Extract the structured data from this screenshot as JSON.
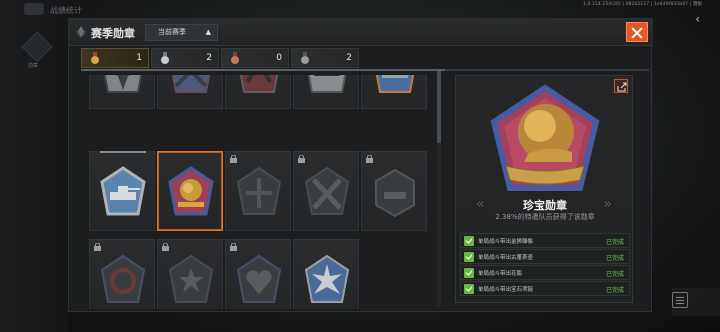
{
  "build_info": "1.0.154.154(20) | 08202117 | 1e449f835b97 | 港服",
  "background": {
    "sidebar_label": "勋章",
    "top_label": "战绩统计"
  },
  "modal": {
    "title": "赛季勋章",
    "season_select": "当前赛季",
    "counters": [
      {
        "icon": "gold-medal-icon",
        "count": "1",
        "color": "#d9a441"
      },
      {
        "icon": "silver-medal-icon",
        "count": "2",
        "color": "#c9ccd0"
      },
      {
        "icon": "bronze-medal-icon",
        "count": "0",
        "color": "#c47a5a"
      },
      {
        "icon": "iron-medal-icon",
        "count": "2",
        "color": "#9a9c9e"
      }
    ]
  },
  "grid": {
    "rows": [
      [
        {
          "id": "medal-cross",
          "locked": false,
          "tier": "silver"
        },
        {
          "id": "medal-crossed-guns",
          "locked": false,
          "tier": "silver"
        },
        {
          "id": "medal-cannons",
          "locked": false,
          "tier": "bronze"
        },
        {
          "id": "medal-helmet",
          "locked": false,
          "tier": "silver"
        },
        {
          "id": "medal-tank-blue",
          "locked": false,
          "tier": "gold"
        }
      ],
      [
        {
          "id": "medal-tank-blue-2",
          "locked": false,
          "tier": "silver",
          "progress": true
        },
        {
          "id": "medal-lion",
          "locked": false,
          "tier": "gold",
          "selected": true
        },
        {
          "id": "medal-tank-cross",
          "locked": true,
          "tier": "dark"
        },
        {
          "id": "medal-crossed-shells",
          "locked": true,
          "tier": "dark"
        },
        {
          "id": "medal-tank-hex",
          "locked": true,
          "tier": "dark"
        }
      ],
      [
        {
          "id": "medal-spiral",
          "locked": true,
          "tier": "dark"
        },
        {
          "id": "medal-star-wreath",
          "locked": true,
          "tier": "dark"
        },
        {
          "id": "medal-heart-shield",
          "locked": true,
          "tier": "dark"
        },
        {
          "id": "medal-starburst",
          "locked": false,
          "tier": "silver"
        }
      ]
    ]
  },
  "detail": {
    "medal_name": "珍宝勋章",
    "description": "2.38%的特遣队员获得了该勋章",
    "tasks": [
      {
        "label": "单局战斗带出金狮雕像",
        "status": "已完成"
      },
      {
        "label": "单局战斗带出古董茶壶",
        "status": "已完成"
      },
      {
        "label": "单局战斗带出花瓶",
        "status": "已完成"
      },
      {
        "label": "单局战斗带出宝石项链",
        "status": "已完成"
      }
    ]
  }
}
